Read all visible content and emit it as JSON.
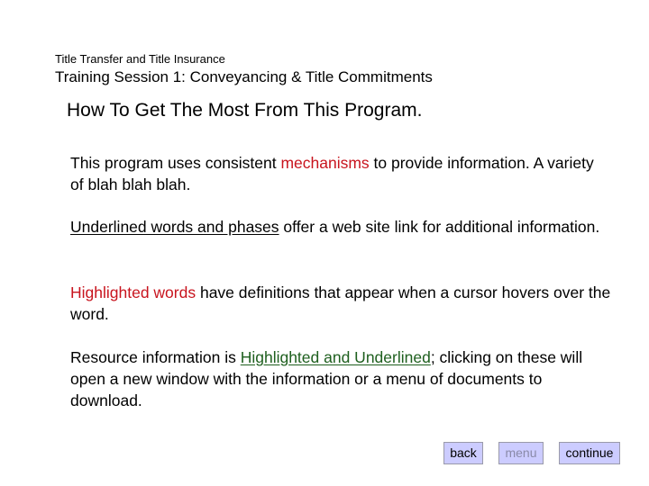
{
  "header": {
    "subtitle": "Title Transfer and Title Insurance",
    "session": "Training Session 1: Conveyancing & Title Commitments"
  },
  "main": {
    "heading": "How To Get The Most From This Program.",
    "paragraphs": {
      "p1": {
        "before": "This program uses consistent ",
        "highlight": "mechanisms",
        "after": " to provide information. A variety of blah blah blah."
      },
      "p2": {
        "link": "Underlined words and phases",
        "after": " offer a web site link for additional information."
      },
      "p3": {
        "highlight": "Highlighted words",
        "after": " have definitions that appear when a cursor hovers over the word."
      },
      "p4": {
        "before": "Resource information is ",
        "link": "Highlighted and Underlined",
        "after": "; clicking on these will open a new window with the information or a menu of documents to download."
      }
    }
  },
  "nav": {
    "back": "back",
    "menu": "menu",
    "continue": "continue"
  },
  "colors": {
    "highlight_red": "#c8141e",
    "resource_green": "#1e5f1e",
    "button_fill": "#ccccff",
    "button_disabled_text": "#8a8aa8"
  }
}
